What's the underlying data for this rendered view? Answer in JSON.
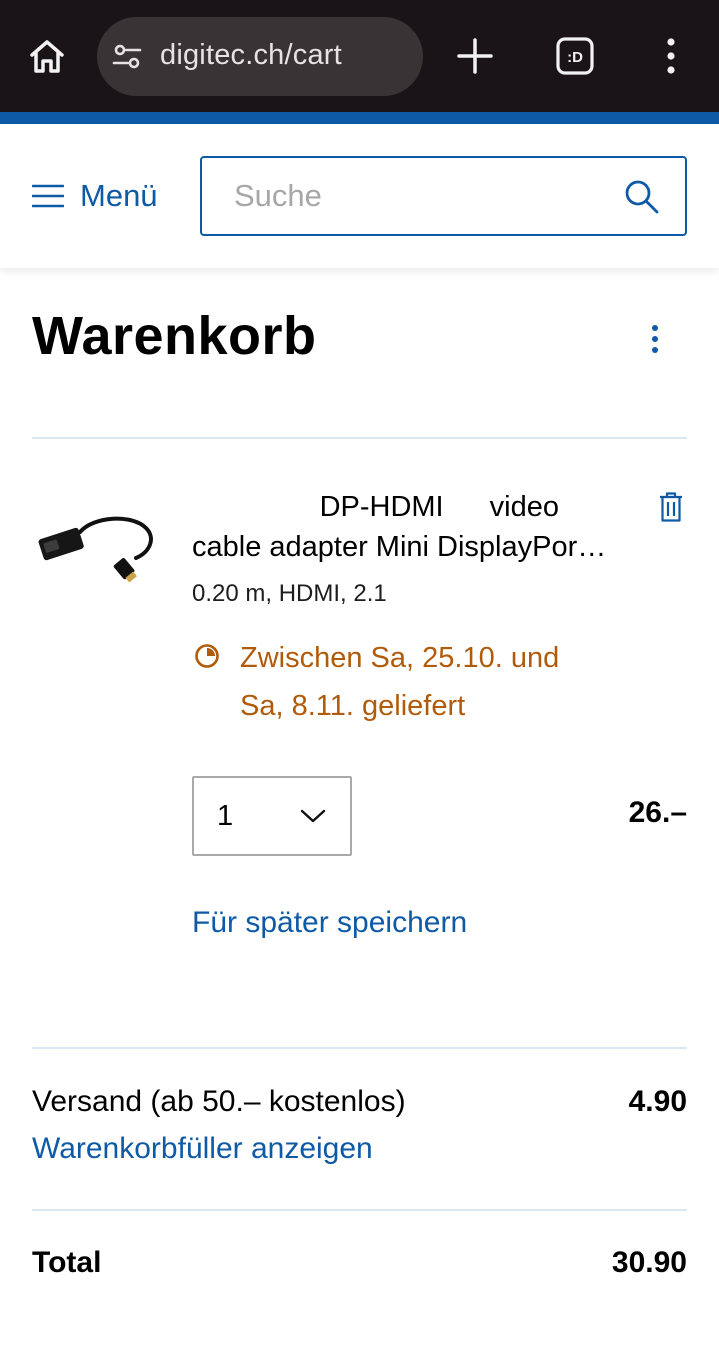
{
  "browser": {
    "url": "digitec.ch/cart",
    "icons": [
      "home-icon",
      "site-settings-icon",
      "new-tab-icon",
      "tab-switcher-icon",
      "more-options-icon"
    ]
  },
  "header": {
    "menu_label": "Menü",
    "search_placeholder": "Suche",
    "accent_color": "#0e5aa7"
  },
  "page": {
    "title": "Warenkorb"
  },
  "cart_item": {
    "title_line1": "DP-HDMI video",
    "title_line2": "cable adapter Mini DisplayPor…",
    "specs": "0.20 m, HDMI, 2.1",
    "delivery_line1": "Zwischen Sa, 25.10. und",
    "delivery_line2": "Sa, 8.11. geliefert",
    "delivery_color": "#b15b0a",
    "quantity": "1",
    "price": "26.–",
    "save_for_later": "Für später speichern"
  },
  "summary": {
    "shipping_label": "Versand (ab 50.– kostenlos)",
    "shipping_value": "4.90",
    "cart_filler_link": "Warenkorbfüller anzeigen",
    "total_label": "Total",
    "total_value": "30.90"
  }
}
